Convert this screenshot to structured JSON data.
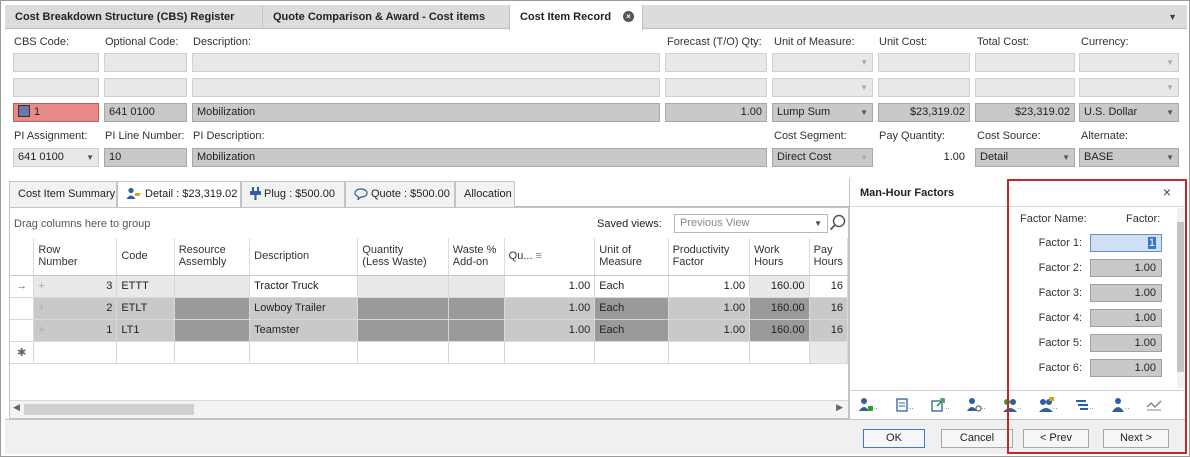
{
  "tabs": [
    {
      "label": "Cost Breakdown Structure (CBS) Register"
    },
    {
      "label": "Quote Comparison & Award - Cost items"
    },
    {
      "label": "Cost Item Record"
    }
  ],
  "header_fields": {
    "cbs_code_label": "CBS Code:",
    "optional_code_label": "Optional Code:",
    "description_label": "Description:",
    "forecast_qty_label": "Forecast (T/O) Qty:",
    "uom_label": "Unit of Measure:",
    "unit_cost_label": "Unit Cost:",
    "total_cost_label": "Total Cost:",
    "currency_label": "Currency:",
    "cbs_code": "1",
    "optional_code": "641 0100",
    "description": "Mobilization",
    "forecast_qty": "1.00",
    "uom": "Lump Sum",
    "unit_cost": "$23,319.02",
    "total_cost": "$23,319.02",
    "currency": "U.S. Dollar",
    "pi_assignment_label": "PI Assignment:",
    "pi_line_number_label": "PI Line Number:",
    "pi_description_label": "PI Description:",
    "cost_segment_label": "Cost Segment:",
    "pay_quantity_label": "Pay Quantity:",
    "cost_source_label": "Cost Source:",
    "alternate_label": "Alternate:",
    "pi_assignment": "641 0100",
    "pi_line_number": "10",
    "pi_description": "Mobilization",
    "cost_segment": "Direct Cost",
    "pay_quantity": "1.00",
    "cost_source": "Detail",
    "alternate": "BASE"
  },
  "inner_tabs": [
    {
      "label": "Cost Item Summary"
    },
    {
      "label": "Detail : $23,319.02"
    },
    {
      "label": "Plug : $500.00"
    },
    {
      "label": "Quote : $500.00"
    },
    {
      "label": "Allocation"
    }
  ],
  "grid": {
    "group_hint": "Drag columns here to group",
    "saved_views_label": "Saved views:",
    "saved_views_placeholder": "Previous View",
    "columns": [
      "Row Number",
      "Code",
      "Resource Assembly",
      "Description",
      "Quantity (Less Waste)",
      "Waste % Add-on",
      "Qu...",
      "Unit of Measure",
      "Productivity Factor",
      "Work Hours",
      "Pay Hours"
    ],
    "col_row_a": "Row",
    "col_row_b": "Number",
    "col_res_a": "Resource",
    "col_res_b": "Assembly",
    "col_qty_a": "Quantity",
    "col_qty_b": "(Less Waste)",
    "col_waste_a": "Waste %",
    "col_waste_b": "Add-on",
    "col_uom_a": "Unit of",
    "col_uom_b": "Measure",
    "col_prod_a": "Productivity",
    "col_prod_b": "Factor",
    "col_work_a": "Work",
    "col_work_b": "Hours",
    "col_pay_a": "Pay",
    "col_pay_b": "Hours",
    "rows": [
      {
        "row": "3",
        "code": "ETTT",
        "description": "Tractor Truck",
        "qu": "1.00",
        "uom": "Each",
        "prod": "1.00",
        "work": "160.00",
        "pay": "16"
      },
      {
        "row": "2",
        "code": "ETLT",
        "description": "Lowboy Trailer",
        "qu": "1.00",
        "uom": "Each",
        "prod": "1.00",
        "work": "160.00",
        "pay": "16"
      },
      {
        "row": "1",
        "code": "LT1",
        "description": "Teamster",
        "qu": "1.00",
        "uom": "Each",
        "prod": "1.00",
        "work": "160.00",
        "pay": "16"
      }
    ]
  },
  "man_hour_panel": {
    "title": "Man-Hour Factors",
    "factor_name_header": "Factor Name:",
    "factor_header": "Factor:",
    "factors": [
      {
        "name": "Factor 1:",
        "value": "1"
      },
      {
        "name": "Factor 2:",
        "value": "1.00"
      },
      {
        "name": "Factor 3:",
        "value": "1.00"
      },
      {
        "name": "Factor 4:",
        "value": "1.00"
      },
      {
        "name": "Factor 5:",
        "value": "1.00"
      },
      {
        "name": "Factor 6:",
        "value": "1.00"
      }
    ]
  },
  "footer": {
    "ok": "OK",
    "cancel": "Cancel",
    "prev": "< Prev",
    "next": "Next >"
  },
  "colors": {
    "highlight_red": "#c0282d",
    "cbs_code_bg": "#e88a8a",
    "accent_blue": "#3b73c6"
  }
}
